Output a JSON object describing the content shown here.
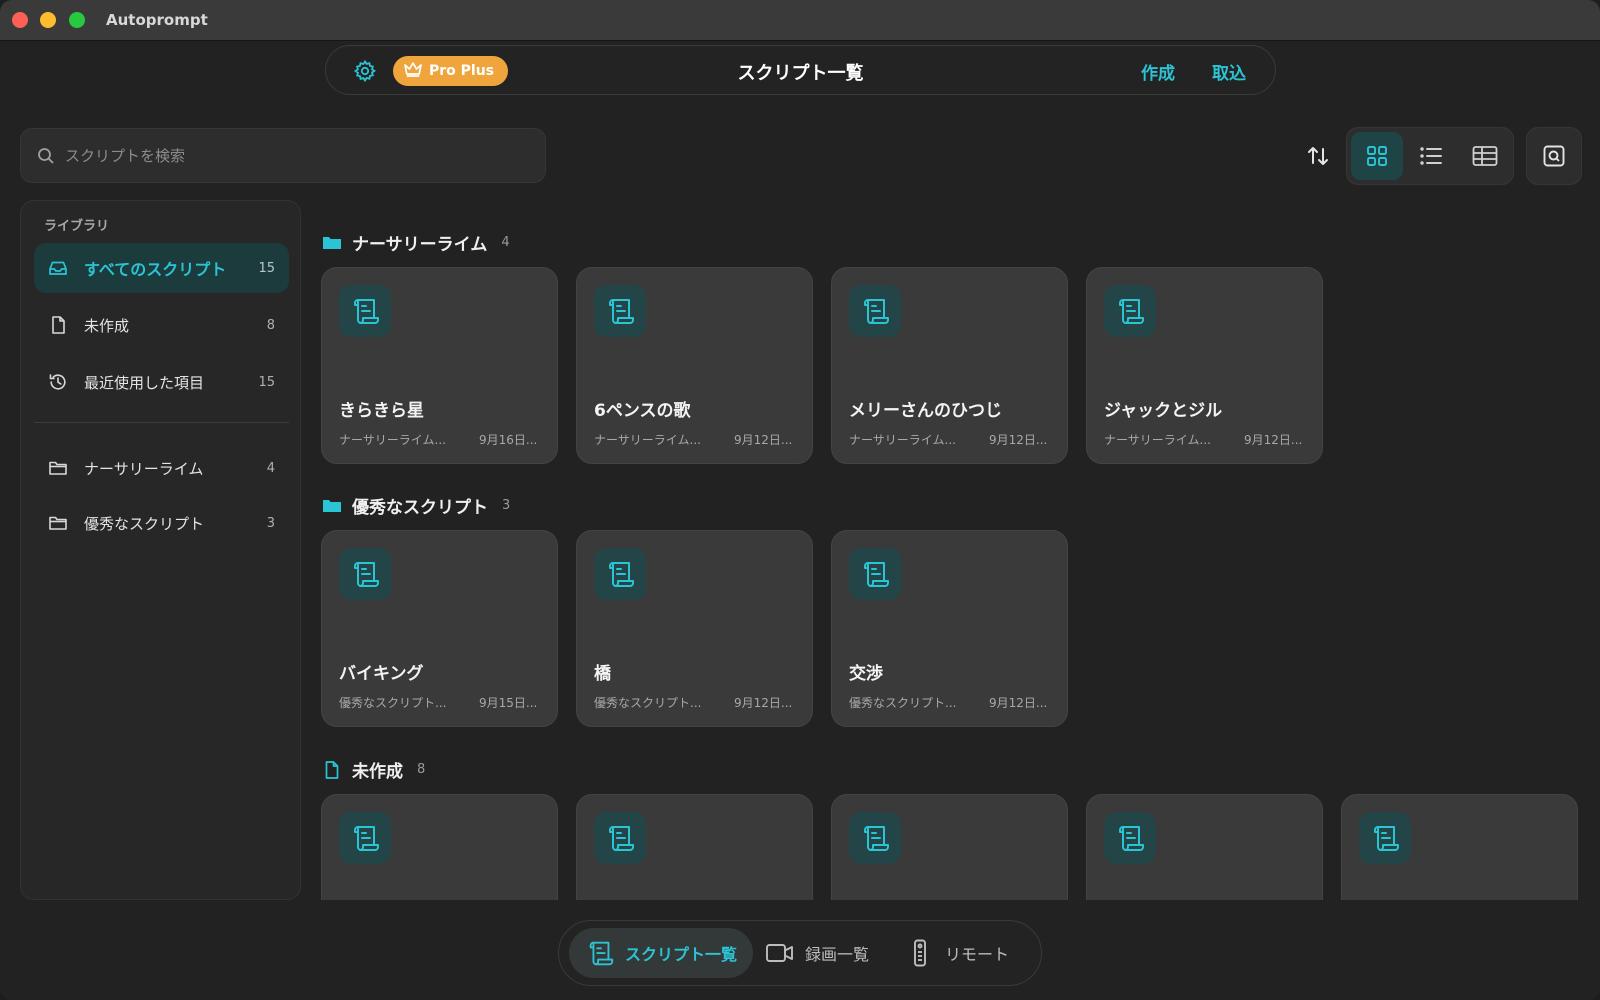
{
  "app": {
    "title": "Autoprompt"
  },
  "topbar": {
    "badge": "Pro Plus",
    "page_title": "スクリプト一覧",
    "create_label": "作成",
    "import_label": "取込"
  },
  "search": {
    "placeholder": "スクリプトを検索",
    "value": ""
  },
  "view_modes": [
    "grid",
    "list",
    "table"
  ],
  "active_view": "grid",
  "sidebar": {
    "heading": "ライブラリ",
    "items": [
      {
        "label": "すべてのスクリプト",
        "count": "15",
        "icon": "tray-icon",
        "active": true
      },
      {
        "label": "未作成",
        "count": "8",
        "icon": "document-icon"
      },
      {
        "label": "最近使用した項目",
        "count": "15",
        "icon": "history-icon"
      }
    ],
    "folders": [
      {
        "label": "ナーサリーライム",
        "count": "4",
        "icon": "folder-icon"
      },
      {
        "label": "優秀なスクリプト",
        "count": "3",
        "icon": "folder-icon"
      }
    ]
  },
  "sections": [
    {
      "title": "ナーサリーライム",
      "count": "4",
      "icon": "folder-filled-icon",
      "cards": [
        {
          "title": "きらきら星",
          "folder": "ナーサリーライム...",
          "date": "9月16日..."
        },
        {
          "title": "6ペンスの歌",
          "folder": "ナーサリーライム...",
          "date": "9月12日..."
        },
        {
          "title": "メリーさんのひつじ",
          "folder": "ナーサリーライム...",
          "date": "9月12日..."
        },
        {
          "title": "ジャックとジル",
          "folder": "ナーサリーライム...",
          "date": "9月12日..."
        }
      ]
    },
    {
      "title": "優秀なスクリプト",
      "count": "3",
      "icon": "folder-filled-icon",
      "cards": [
        {
          "title": "バイキング",
          "folder": "優秀なスクリプト...",
          "date": "9月15日..."
        },
        {
          "title": "橋",
          "folder": "優秀なスクリプト...",
          "date": "9月12日..."
        },
        {
          "title": "交渉",
          "folder": "優秀なスクリプト...",
          "date": "9月12日..."
        }
      ]
    },
    {
      "title": "未作成",
      "count": "8",
      "icon": "document-icon",
      "cards": [
        {
          "title": "",
          "folder": "",
          "date": ""
        },
        {
          "title": "",
          "folder": "",
          "date": ""
        },
        {
          "title": "",
          "folder": "",
          "date": ""
        },
        {
          "title": "",
          "folder": "",
          "date": ""
        },
        {
          "title": "",
          "folder": "",
          "date": ""
        }
      ]
    }
  ],
  "bottom_tabs": [
    {
      "label": "スクリプト一覧",
      "icon": "script-icon",
      "active": true
    },
    {
      "label": "録画一覧",
      "icon": "video-camera-icon"
    },
    {
      "label": "リモート",
      "icon": "remote-icon"
    }
  ],
  "colors": {
    "accent": "#2bc4d4",
    "badge": "#f0a53c",
    "background": "#222222",
    "card": "#3a3a3a"
  }
}
